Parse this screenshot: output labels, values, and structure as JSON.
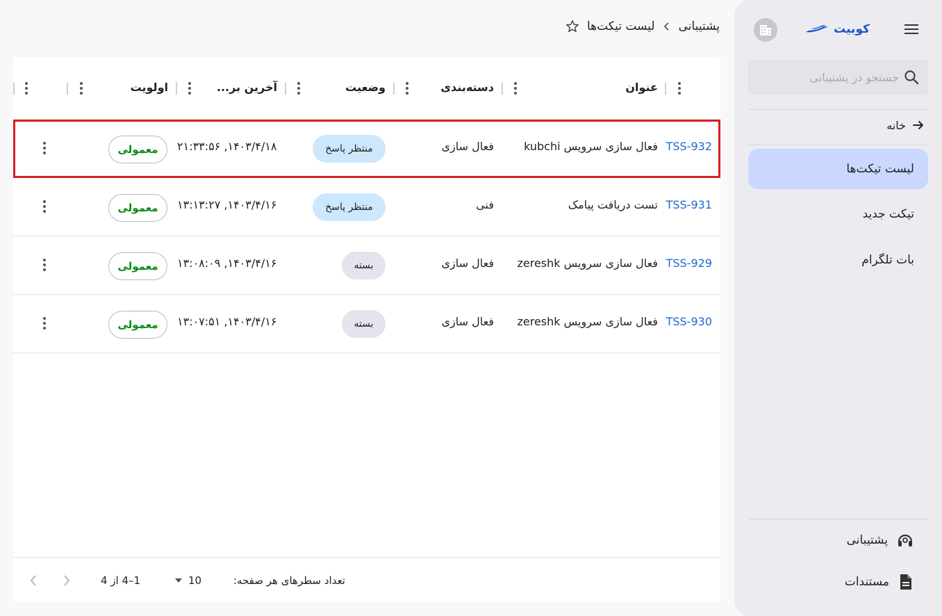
{
  "sidebar": {
    "brand": "کوبیت",
    "search_placeholder": "جستجو در پشتیبانی",
    "home": "خانه",
    "items": [
      {
        "label": "لیست تیکت‌ها",
        "active": true
      },
      {
        "label": "تیکت جدید",
        "active": false
      },
      {
        "label": "بات تلگرام",
        "active": false
      }
    ],
    "footer": {
      "support": "پشتیبانی",
      "docs": "مستندات"
    }
  },
  "breadcrumb": {
    "parent": "پشتیبانی",
    "current": "لیست تیکت‌ها"
  },
  "table": {
    "columns": {
      "title": "عنوان",
      "category": "دسته‌بندی",
      "status": "وضعیت",
      "last_update": "آخرین بر...",
      "priority": "اولویت"
    },
    "rows": [
      {
        "id": "TSS-932",
        "title": "فعال سازی سرویس kubchi",
        "category": "فعال سازی",
        "status": "منتظر پاسخ",
        "status_type": "waiting",
        "date": "۱۴۰۳/۴/۱۸, ۲۱:۳۳:۵۶",
        "priority": "معمولی"
      },
      {
        "id": "TSS-931",
        "title": "تست دریافت پیامک",
        "category": "فنی",
        "status": "منتظر پاسخ",
        "status_type": "waiting",
        "date": "۱۴۰۳/۴/۱۶, ۱۳:۱۳:۲۷",
        "priority": "معمولی"
      },
      {
        "id": "TSS-929",
        "title": "فعال سازی سرویس zereshk",
        "category": "فعال سازی",
        "status": "بسته",
        "status_type": "closed",
        "date": "۱۴۰۳/۴/۱۶, ۱۳:۰۸:۰۹",
        "priority": "معمولی"
      },
      {
        "id": "TSS-930",
        "title": "فعال سازی سرویس zereshk",
        "category": "فعال سازی",
        "status": "بسته",
        "status_type": "closed",
        "date": "۱۴۰۳/۴/۱۶, ۱۳:۰۷:۵۱",
        "priority": "معمولی"
      }
    ]
  },
  "pagination": {
    "rows_per_page_label": "تعداد سطرهای هر صفحه:",
    "rows_per_page": "10",
    "range": "1–4 از 4"
  },
  "colors": {
    "accent": "#1b6ad0",
    "active_nav": "#cad8ff",
    "priority_text": "#0a8a14",
    "selected_outline": "#d71f1f"
  }
}
